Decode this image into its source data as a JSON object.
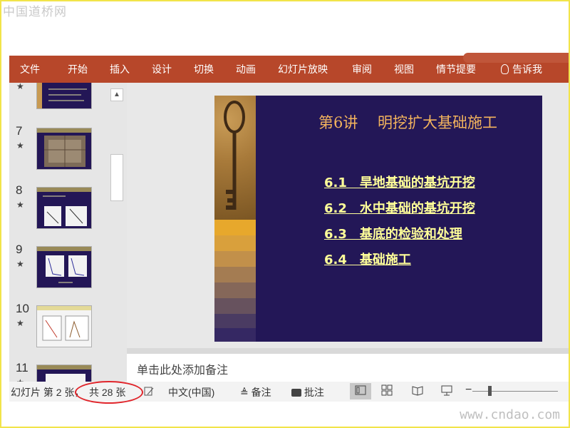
{
  "watermark": {
    "top": "中国道桥网",
    "bottom": "www.cndao.com"
  },
  "ribbon": {
    "tabs": [
      "文件",
      "开始",
      "插入",
      "设计",
      "切换",
      "动画",
      "幻灯片放映",
      "审阅",
      "视图",
      "情节提要"
    ],
    "tell_me": "告诉我"
  },
  "thumbnails": [
    {
      "number": "",
      "star": "★"
    },
    {
      "number": "7",
      "star": "★"
    },
    {
      "number": "8",
      "star": "★"
    },
    {
      "number": "9",
      "star": "★"
    },
    {
      "number": "10",
      "star": "★"
    },
    {
      "number": "11",
      "star": "★"
    }
  ],
  "slide": {
    "title": "第6讲　 明挖扩大基础施工",
    "items": [
      "6.1　旱地基础的基坑开挖",
      "6.2　水中基础的基坑开挖",
      "6.3　基底的检验和处理",
      "6.4　基础施工"
    ]
  },
  "notes": {
    "placeholder": "单击此处添加备注"
  },
  "status": {
    "slide_info": "幻灯片 第 2 张，",
    "total": "共 28 张",
    "language": "中文(中国)",
    "notes_button": "备注",
    "comments_button": "批注"
  },
  "colors": {
    "ribbon": "#b7472a",
    "slide_bg": "#231757",
    "title": "#f2b35d",
    "toc": "#ffff99",
    "highlight": "#e0242a"
  }
}
